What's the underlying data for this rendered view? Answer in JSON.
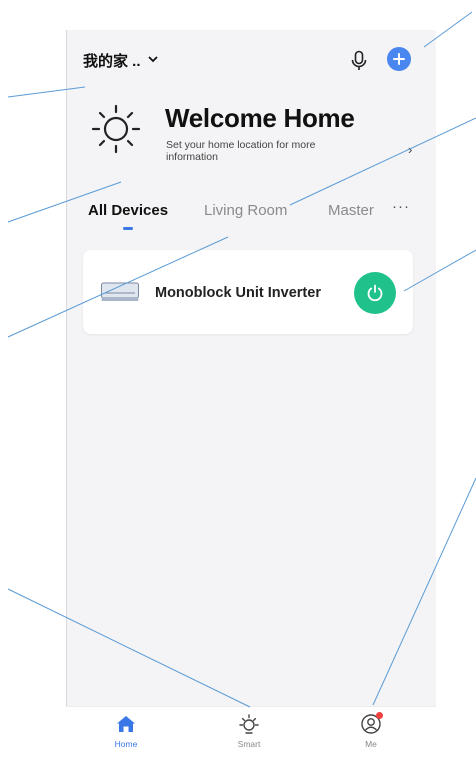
{
  "header": {
    "home_name": "我的家 ..",
    "home_dropdown_icon": "chevron-down-icon",
    "mic_icon": "microphone-icon",
    "add_icon": "plus-circle-icon"
  },
  "welcome": {
    "icon": "sun-icon",
    "title": "Welcome Home",
    "subtitle": "Set your home location for more information",
    "arrow": "›"
  },
  "tabs": [
    {
      "label": "All Devices",
      "active": true
    },
    {
      "label": "Living Room",
      "active": false
    },
    {
      "label": "Master",
      "active": false
    }
  ],
  "tabs_more": "···",
  "devices": [
    {
      "name": "Monoblock Unit Inverter",
      "icon": "air-conditioner-icon",
      "power_icon": "power-icon",
      "power_color": "#1fc28a"
    }
  ],
  "bottom_nav": [
    {
      "label": "Home",
      "icon": "home-icon",
      "active": true
    },
    {
      "label": "Smart",
      "icon": "sun-icon",
      "active": false
    },
    {
      "label": "Me",
      "icon": "user-icon",
      "active": false,
      "badge": true
    }
  ],
  "colors": {
    "accent": "#3b78e7",
    "add_button": "#4a86f0",
    "power_on": "#1fc28a",
    "badge": "#f04040",
    "annotation_line": "#5b9bd5"
  }
}
